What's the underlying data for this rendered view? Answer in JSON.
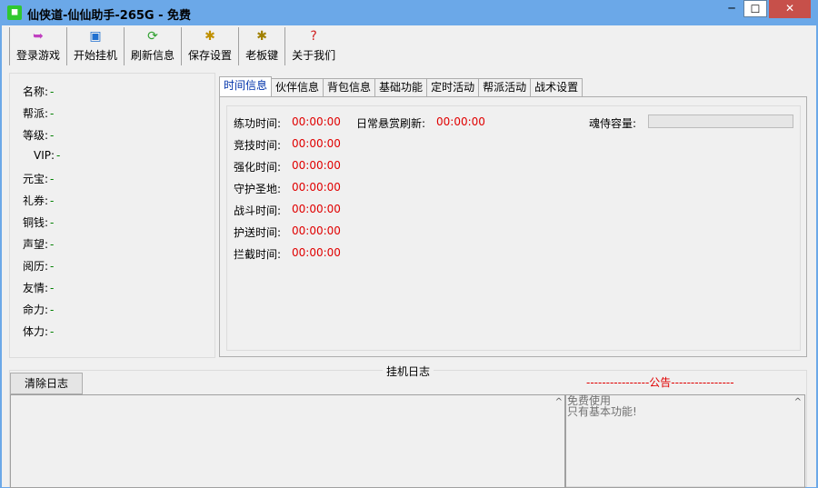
{
  "window": {
    "title": "仙侠道-仙仙助手-265G - 免费",
    "minimize": "─",
    "maximize": "☐",
    "close": "✕"
  },
  "toolbar": [
    {
      "label": "登录游戏",
      "icon": "login-icon",
      "glyph": "➥",
      "color": "#c040c0"
    },
    {
      "label": "开始挂机",
      "icon": "start-icon",
      "glyph": "▣",
      "color": "#2070d0"
    },
    {
      "label": "刷新信息",
      "icon": "refresh-icon",
      "glyph": "⟳",
      "color": "#30a030"
    },
    {
      "label": "保存设置",
      "icon": "save-settings-icon",
      "glyph": "✱",
      "color": "#c09000"
    },
    {
      "label": "老板键",
      "icon": "boss-key-icon",
      "glyph": "✱",
      "color": "#a08000"
    },
    {
      "label": "关于我们",
      "icon": "about-icon",
      "glyph": "?",
      "color": "#d02020"
    }
  ],
  "info": [
    {
      "label": "名称:",
      "value": "-"
    },
    {
      "label": "帮派:",
      "value": "-"
    },
    {
      "label": "等级:",
      "value": "-"
    },
    {
      "label": "VIP:",
      "value": "-"
    },
    {
      "label": "元宝:",
      "value": "-"
    },
    {
      "label": "礼券:",
      "value": "-"
    },
    {
      "label": "铜钱:",
      "value": "-"
    },
    {
      "label": "声望:",
      "value": "-"
    },
    {
      "label": "阅历:",
      "value": "-"
    },
    {
      "label": "友情:",
      "value": "-"
    },
    {
      "label": "命力:",
      "value": "-"
    },
    {
      "label": "体力:",
      "value": "-"
    }
  ],
  "tabs": [
    "时间信息",
    "伙伴信息",
    "背包信息",
    "基础功能",
    "定时活动",
    "帮派活动",
    "战术设置"
  ],
  "timers": [
    {
      "label": "练功时间:",
      "value": "00:00:00"
    },
    {
      "label": "竞技时间:",
      "value": "00:00:00"
    },
    {
      "label": "强化时间:",
      "value": "00:00:00"
    },
    {
      "label": "守护圣地:",
      "value": "00:00:00"
    },
    {
      "label": "战斗时间:",
      "value": "00:00:00"
    },
    {
      "label": "护送时间:",
      "value": "00:00:00"
    },
    {
      "label": "拦截时间:",
      "value": "00:00:00"
    }
  ],
  "daily": {
    "label": "日常悬赏刷新:",
    "value": "00:00:00"
  },
  "soul": {
    "label": "魂侍容量:"
  },
  "log": {
    "title": "挂机日志",
    "clear": "清除日志",
    "notice_header": "----------------公告----------------",
    "notice_lines": [
      "免费使用",
      "只有基本功能!"
    ]
  }
}
